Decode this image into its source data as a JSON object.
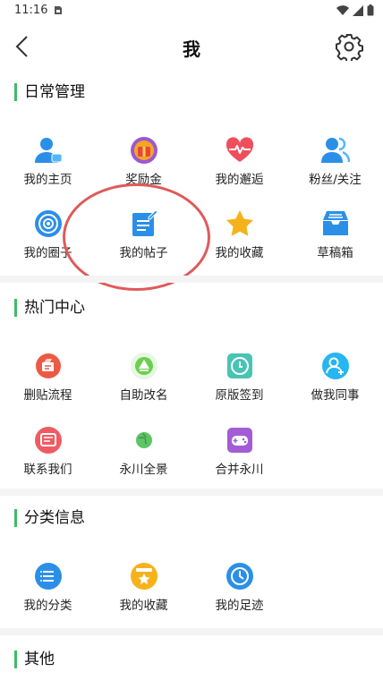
{
  "status_bar": {
    "time": "11:16"
  },
  "header": {
    "title": "我"
  },
  "sections": {
    "daily": {
      "title": "日常管理",
      "items": [
        {
          "label": "我的主页",
          "icon": "user-profile-icon"
        },
        {
          "label": "奖励金",
          "icon": "reward-icon"
        },
        {
          "label": "我的邂逅",
          "icon": "heart-pulse-icon"
        },
        {
          "label": "粉丝/关注",
          "icon": "followers-icon"
        },
        {
          "label": "我的圈子",
          "icon": "circle-target-icon"
        },
        {
          "label": "我的帖子",
          "icon": "post-edit-icon"
        },
        {
          "label": "我的收藏",
          "icon": "star-icon"
        },
        {
          "label": "草稿箱",
          "icon": "draft-box-icon"
        }
      ]
    },
    "hot": {
      "title": "热门中心",
      "items": [
        {
          "label": "删贴流程",
          "icon": "delete-post-icon"
        },
        {
          "label": "自助改名",
          "icon": "rename-icon"
        },
        {
          "label": "原版签到",
          "icon": "check-in-icon"
        },
        {
          "label": "做我同事",
          "icon": "add-colleague-icon"
        },
        {
          "label": "联系我们",
          "icon": "contact-message-icon"
        },
        {
          "label": "永川全景",
          "icon": "panorama-icon"
        },
        {
          "label": "合并永川",
          "icon": "gamepad-icon"
        }
      ]
    },
    "category": {
      "title": "分类信息",
      "items": [
        {
          "label": "我的分类",
          "icon": "category-list-icon"
        },
        {
          "label": "我的收藏",
          "icon": "favorite-box-icon"
        },
        {
          "label": "我的足迹",
          "icon": "clock-footprint-icon"
        }
      ]
    },
    "other": {
      "title": "其他"
    }
  },
  "colors": {
    "accent_green": "#3dbd64",
    "annotation_red": "#e05a5a"
  }
}
